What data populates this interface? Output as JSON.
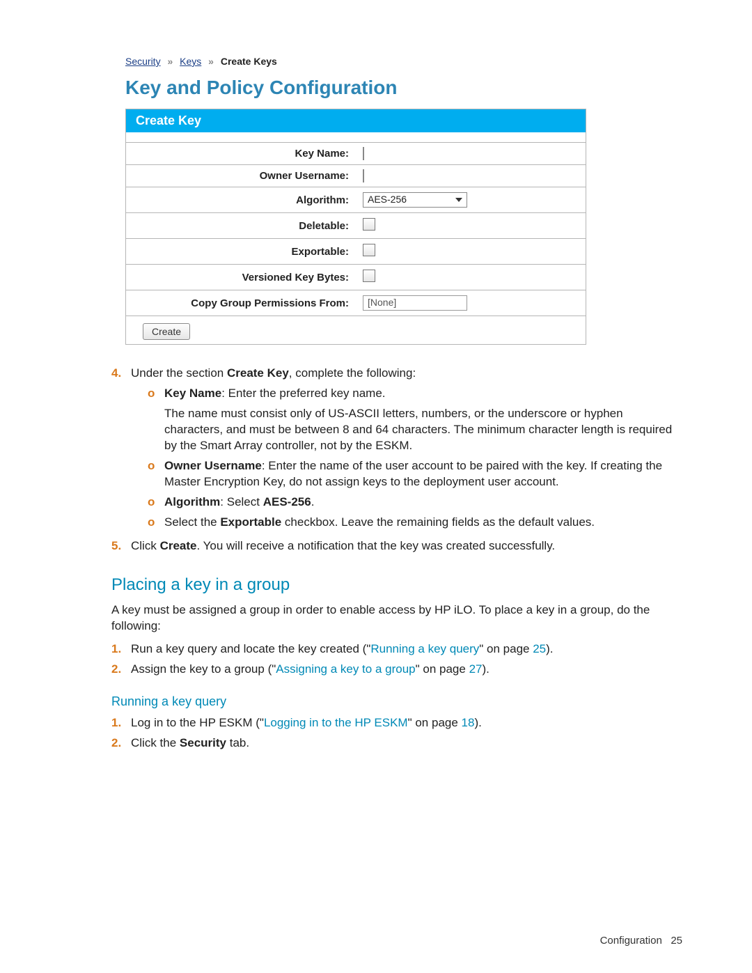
{
  "screenshot": {
    "breadcrumb": {
      "l1": "Security",
      "sep": "»",
      "l2": "Keys",
      "current": "Create Keys"
    },
    "title": "Key and Policy Configuration",
    "panel_title": "Create Key",
    "fields": {
      "key_name": "Key Name:",
      "owner": "Owner Username:",
      "algorithm": "Algorithm:",
      "algorithm_value": "AES-256",
      "deletable": "Deletable:",
      "exportable": "Exportable:",
      "versioned": "Versioned Key Bytes:",
      "copy_perms": "Copy Group Permissions From:",
      "copy_perms_value": "[None]"
    },
    "create_btn": "Create"
  },
  "steps": {
    "s4": {
      "num": "4.",
      "text_pre": "Under the section ",
      "text_bold": "Create Key",
      "text_post": ", complete the following:"
    },
    "s4a": {
      "label": "Key Name",
      "rest": ": Enter the preferred key name.",
      "cont": "The name must consist only of US-ASCII letters, numbers, or the underscore or hyphen characters, and must be between 8 and 64 characters. The minimum character length is required by the Smart Array controller, not by the ESKM."
    },
    "s4b": {
      "label": "Owner Username",
      "rest": ": Enter the name of the user account to be paired with the key. If creating the Master Encryption Key, do not assign keys to the deployment user account."
    },
    "s4c": {
      "label": "Algorithm",
      "mid": ": Select ",
      "value": "AES-256",
      "end": "."
    },
    "s4d": {
      "pre": "Select the ",
      "bold": "Exportable",
      "post": " checkbox. Leave the remaining fields as the default values."
    },
    "s5": {
      "num": "5.",
      "pre": "Click ",
      "bold": "Create",
      "post": ". You will receive a notification that the key was created successfully."
    }
  },
  "section2": {
    "title": "Placing a key in a group",
    "intro": "A key must be assigned a group in order to enable access by HP iLO. To place a key in a group, do the following:",
    "step1": {
      "num": "1.",
      "pre": "Run a key query and locate the key created (\"",
      "link": "Running a key query",
      "mid": "\" on page ",
      "page": "25",
      "end": ")."
    },
    "step2": {
      "num": "2.",
      "pre": "Assign the key to a group (\"",
      "link": "Assigning a key to a group",
      "mid": "\" on page ",
      "page": "27",
      "end": ")."
    }
  },
  "section3": {
    "title": "Running a key query",
    "step1": {
      "num": "1.",
      "pre": "Log in to the HP ESKM (\"",
      "link": "Logging in to the HP ESKM",
      "mid": "\" on page ",
      "page": "18",
      "end": ")."
    },
    "step2": {
      "num": "2.",
      "pre": "Click the ",
      "bold": "Security",
      "post": " tab."
    }
  },
  "footer": {
    "label": "Configuration",
    "page": "25"
  }
}
